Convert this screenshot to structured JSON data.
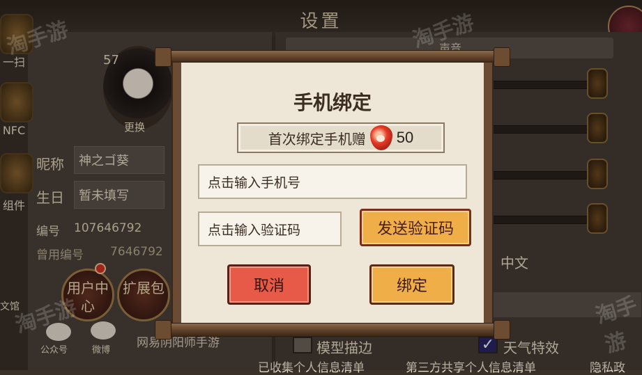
{
  "background": {
    "title": "设置",
    "sound_label": "声音",
    "left_icons": [
      "一扫",
      "NFC",
      "组件"
    ],
    "avatar_level": "57",
    "avatar_change": "更换",
    "nickname_label": "昵称",
    "nickname_value": "神之ゴ葵",
    "birthday_label": "生日",
    "birthday_value": "暂未填写",
    "id_label": "编号",
    "id_value": "107646792",
    "old_id_label": "曾用编号",
    "old_id_value": "7646792",
    "user_center": "用户中心",
    "expand_pack": "扩展包",
    "social_wechat": "公众号",
    "social_weibo": "微博",
    "game_name": "网易阴阳师手游",
    "language": "中文",
    "model_outline": "模型描边",
    "weather_effect": "天气特效",
    "footer_collected": "已收集个人信息清单",
    "footer_third_party": "第三方共享个人信息清单",
    "footer_privacy": "隐私政",
    "left_edge_label": "文馆",
    "watermark": "淘手游"
  },
  "modal": {
    "title": "手机绑定",
    "reward_text": "首次绑定手机赠",
    "reward_value": "50",
    "reward_icon": "magatama-icon",
    "phone_placeholder": "点击输入手机号",
    "code_placeholder": "点击输入验证码",
    "send_code_label": "发送验证码",
    "cancel_label": "取消",
    "bind_label": "绑定"
  },
  "colors": {
    "scroll_paper": "#eee6d6",
    "orange_button": "#f0ae48",
    "red_button": "#e75a48",
    "wood": "#6a4c34"
  }
}
